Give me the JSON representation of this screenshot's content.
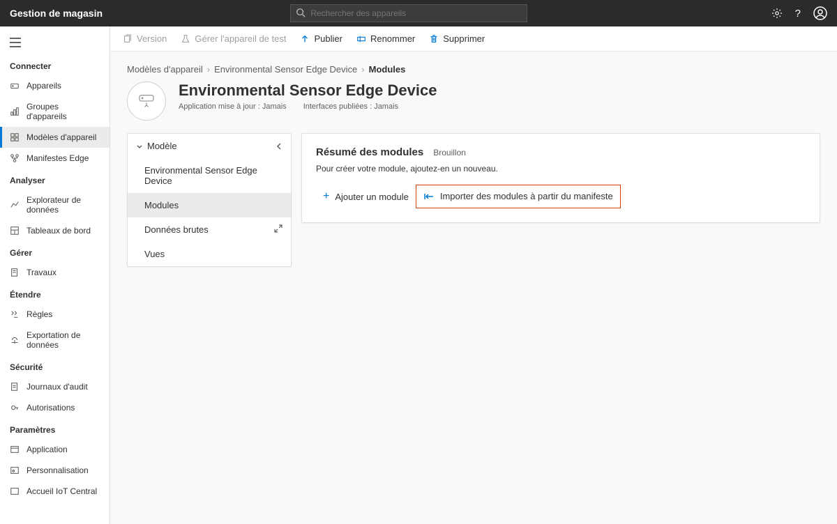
{
  "topbar": {
    "title": "Gestion de magasin",
    "searchPlaceholder": "Rechercher des appareils"
  },
  "sidebar": {
    "sections": [
      {
        "label": "Connecter",
        "items": [
          {
            "label": "Appareils"
          },
          {
            "label": "Groupes d'appareils"
          },
          {
            "label": "Modèles d'appareil",
            "active": true
          },
          {
            "label": "Manifestes Edge"
          }
        ]
      },
      {
        "label": "Analyser",
        "items": [
          {
            "label": "Explorateur de données"
          },
          {
            "label": "Tableaux de bord"
          }
        ]
      },
      {
        "label": "Gérer",
        "items": [
          {
            "label": "Travaux"
          }
        ]
      },
      {
        "label": "Étendre",
        "items": [
          {
            "label": "Règles"
          },
          {
            "label": "Exportation de données"
          }
        ]
      },
      {
        "label": "Sécurité",
        "items": [
          {
            "label": "Journaux d'audit"
          },
          {
            "label": "Autorisations"
          }
        ]
      },
      {
        "label": "Paramètres",
        "items": [
          {
            "label": "Application"
          },
          {
            "label": "Personnalisation"
          },
          {
            "label": "Accueil IoT Central"
          }
        ]
      }
    ]
  },
  "toolbar": {
    "version": "Version",
    "manageTest": "Gérer l'appareil de test",
    "publish": "Publier",
    "rename": "Renommer",
    "delete": "Supprimer"
  },
  "breadcrumb": {
    "root": "Modèles d'appareil",
    "device": "Environmental Sensor Edge Device",
    "current": "Modules"
  },
  "device": {
    "title": "Environmental Sensor Edge Device",
    "meta1": "Application mise à jour : Jamais",
    "meta2": "Interfaces publiées : Jamais"
  },
  "modelPanel": {
    "heading": "Modèle",
    "items": [
      {
        "label": "Environmental Sensor Edge Device"
      },
      {
        "label": "Modules",
        "selected": true
      },
      {
        "label": "Données brutes",
        "expandable": true
      },
      {
        "label": "Vues"
      }
    ]
  },
  "summary": {
    "title": "Résumé des modules",
    "status": "Brouillon",
    "description": "Pour créer votre module, ajoutez-en un nouveau.",
    "addModule": "Ajouter un module",
    "importModules": "Importer des modules à partir du manifeste"
  }
}
